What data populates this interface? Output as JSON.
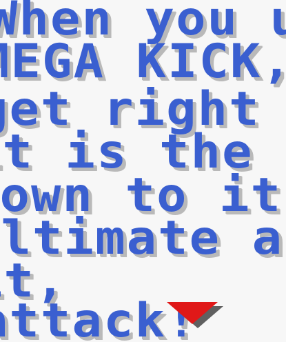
{
  "dialog": {
    "lines": [
      "When you use",
      "MEGA KICK,",
      "get right down",
      "it is the ult",
      "down to its",
      "ultimate attack",
      "it,",
      "attack!"
    ],
    "colors": {
      "text": "#3a5fd0",
      "shadow": "#b9b9b9",
      "background": "#f7f7f7",
      "arrow": "#e01818",
      "arrow_shadow": "#606060"
    },
    "more_indicator": "red-down-triangle-icon"
  }
}
